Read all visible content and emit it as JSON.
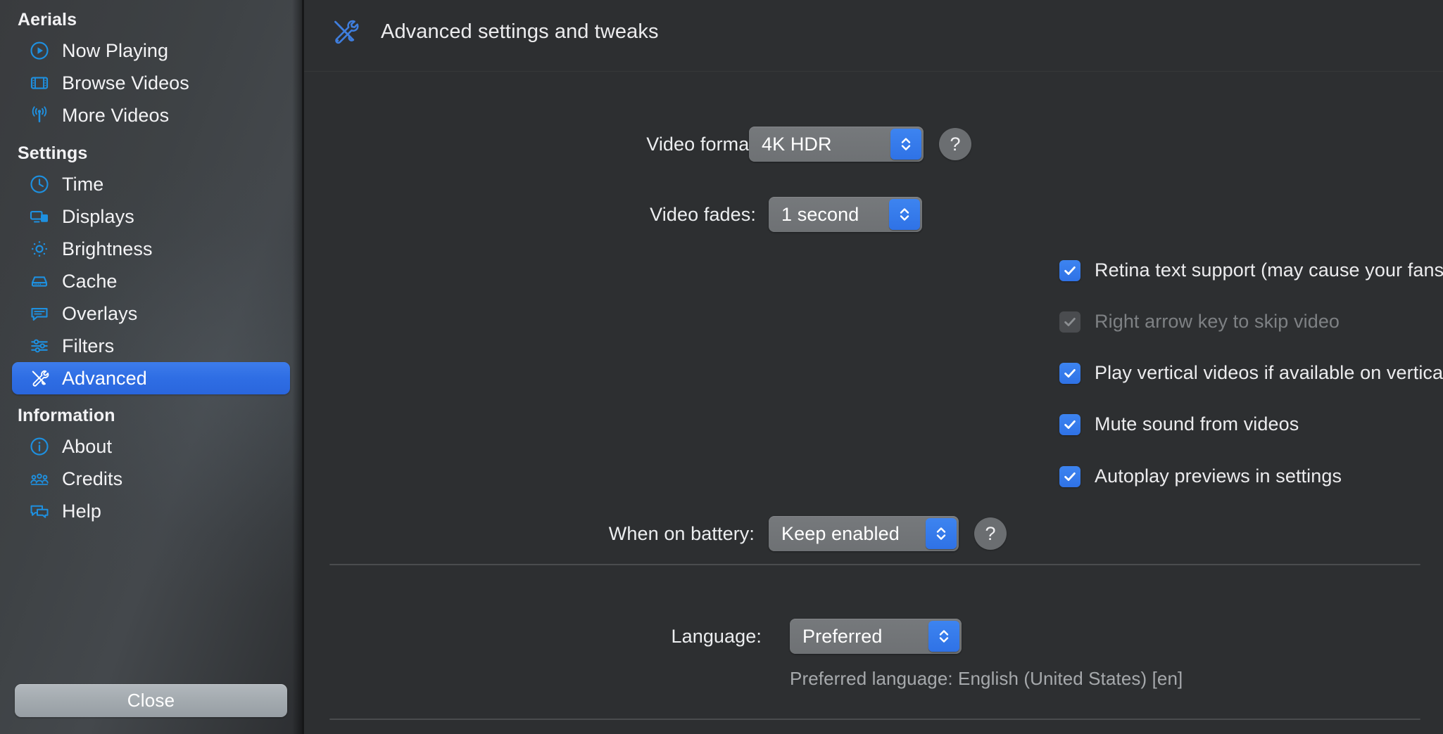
{
  "sidebar": {
    "groups": [
      {
        "title": "Aerials",
        "items": [
          {
            "label": "Now Playing",
            "icon": "play-circle-icon"
          },
          {
            "label": "Browse Videos",
            "icon": "film-strip-icon"
          },
          {
            "label": "More Videos",
            "icon": "broadcast-antenna-icon"
          }
        ]
      },
      {
        "title": "Settings",
        "items": [
          {
            "label": "Time",
            "icon": "clock-icon"
          },
          {
            "label": "Displays",
            "icon": "displays-icon"
          },
          {
            "label": "Brightness",
            "icon": "sun-brightness-icon"
          },
          {
            "label": "Cache",
            "icon": "hard-drive-icon"
          },
          {
            "label": "Overlays",
            "icon": "speech-bubble-icon"
          },
          {
            "label": "Filters",
            "icon": "sliders-icon"
          },
          {
            "label": "Advanced",
            "icon": "tools-icon",
            "selected": true
          }
        ]
      },
      {
        "title": "Information",
        "items": [
          {
            "label": "About",
            "icon": "info-circle-icon"
          },
          {
            "label": "Credits",
            "icon": "people-group-icon"
          },
          {
            "label": "Help",
            "icon": "chat-bubbles-icon"
          }
        ]
      }
    ],
    "close_label": "Close"
  },
  "header": {
    "icon": "tools-icon",
    "title": "Advanced settings and tweaks"
  },
  "settings": {
    "video_format": {
      "label": "Video format",
      "value": "4K HDR",
      "help_label": "?"
    },
    "video_fades": {
      "label": "Video fades:",
      "value": "1 second"
    },
    "checkboxes": [
      {
        "label": "Retina text support (may cause your fans to spin on Intel Macs)",
        "checked": true,
        "disabled": false
      },
      {
        "label": "Right arrow key to skip video",
        "checked": true,
        "disabled": true
      },
      {
        "label": "Play vertical videos if available on vertical screens",
        "checked": true,
        "disabled": false
      },
      {
        "label": "Mute sound from videos",
        "checked": true,
        "disabled": false
      },
      {
        "label": "Autoplay previews in settings",
        "checked": true,
        "disabled": false
      }
    ],
    "when_on_battery": {
      "label": "When on battery:",
      "value": "Keep enabled",
      "help_label": "?"
    },
    "language": {
      "label": "Language:",
      "value": "Preferred",
      "note": "Preferred language: English (United States) [en]"
    }
  },
  "colors": {
    "accent_blue": "#2f72e6",
    "selected_gradient_start": "#3d7ceb",
    "sidebar_icon_blue": "#1e90e0",
    "panel_background": "#2d2f31",
    "disabled_text": "#7e8184"
  }
}
